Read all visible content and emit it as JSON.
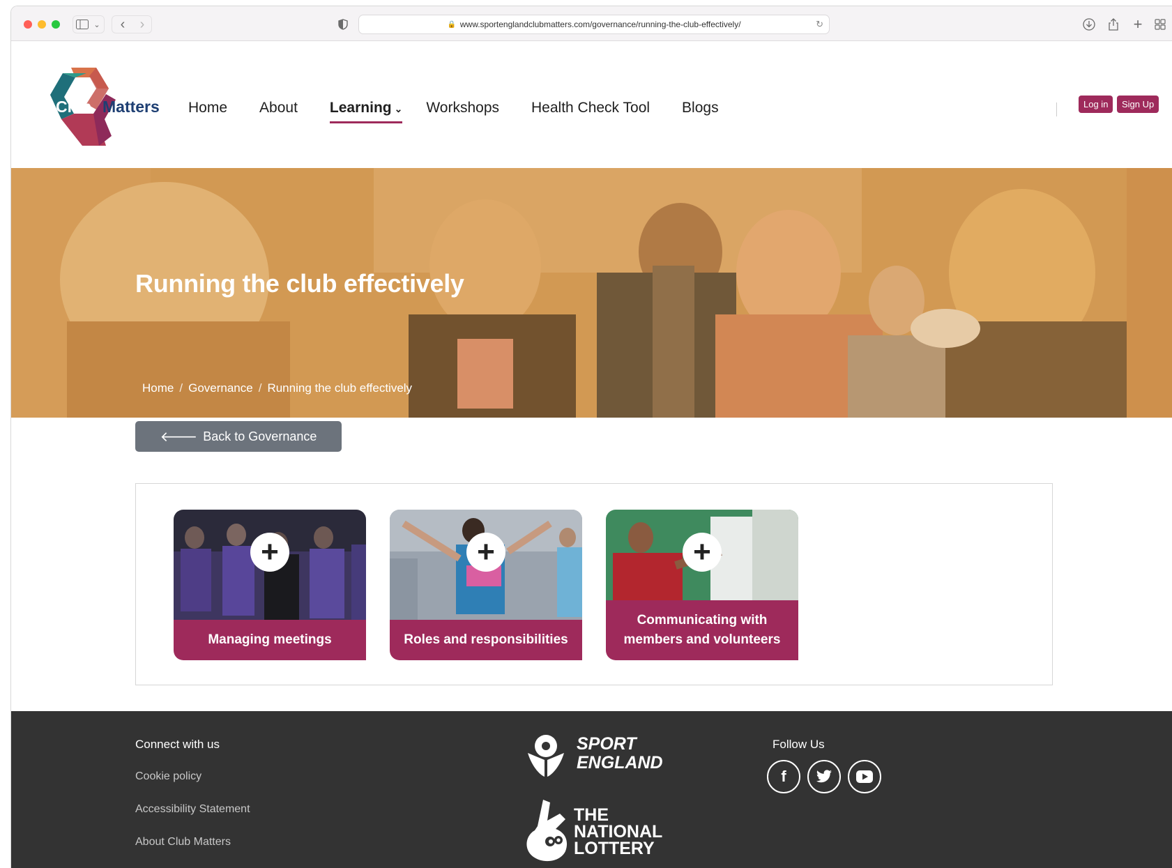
{
  "browser": {
    "url": "www.sportenglandclubmatters.com/governance/running-the-club-effectively/"
  },
  "header": {
    "logo_left": "Club",
    "logo_right": "Matters",
    "nav": [
      {
        "label": "Home"
      },
      {
        "label": "About"
      },
      {
        "label": "Learning"
      },
      {
        "label": "Workshops"
      },
      {
        "label": "Health Check Tool"
      },
      {
        "label": "Blogs"
      }
    ],
    "login_label": "Log in",
    "signup_label": "Sign Up"
  },
  "hero": {
    "title": "Running the club effectively",
    "breadcrumb": [
      "Home",
      "Governance",
      "Running the club effectively"
    ],
    "breadcrumb_sep": "/"
  },
  "back_button": {
    "label": "Back to Governance"
  },
  "cards": [
    {
      "label": "Managing meetings"
    },
    {
      "label": "Roles and responsibilities"
    },
    {
      "label": "Communicating with members and volunteers"
    }
  ],
  "footer": {
    "connect_heading": "Connect with us",
    "links": [
      "Cookie policy",
      "Accessibility Statement",
      "About Club Matters"
    ],
    "sport_england_line1": "SPORT",
    "sport_england_line2": "ENGLAND",
    "lottery_line1": "THE",
    "lottery_line2": "NATIONAL",
    "lottery_line3": "LOTTERY",
    "follow_heading": "Follow Us",
    "social": [
      "facebook-icon",
      "twitter-icon",
      "youtube-icon"
    ]
  },
  "colors": {
    "brand": "#9e2a5b",
    "footer": "#333333",
    "back_button": "#6c737c"
  }
}
